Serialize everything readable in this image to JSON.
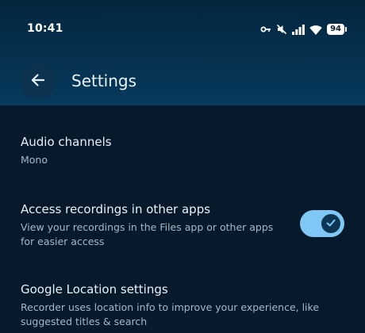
{
  "status_bar": {
    "time": "10:41",
    "battery": "94",
    "icons": [
      "vpn-key-icon",
      "mute-icon",
      "signal-icon",
      "wifi-icon",
      "battery-icon"
    ]
  },
  "header": {
    "title": "Settings",
    "back_icon": "arrow-left-icon"
  },
  "settings": {
    "audio_channels": {
      "title": "Audio channels",
      "value": "Mono"
    },
    "access_recordings": {
      "title": "Access recordings in other apps",
      "description": "View your recordings in the Files app or other apps for easier access",
      "toggle_on": true
    },
    "google_location": {
      "title": "Google Location settings",
      "description": "Recorder uses location info to improve your experience, like suggested titles & search"
    }
  },
  "colors": {
    "header_bg": "#073a5c",
    "page_bg": "#061a2c",
    "toggle_track": "#7fc8f5",
    "toggle_thumb": "#0c3553"
  }
}
